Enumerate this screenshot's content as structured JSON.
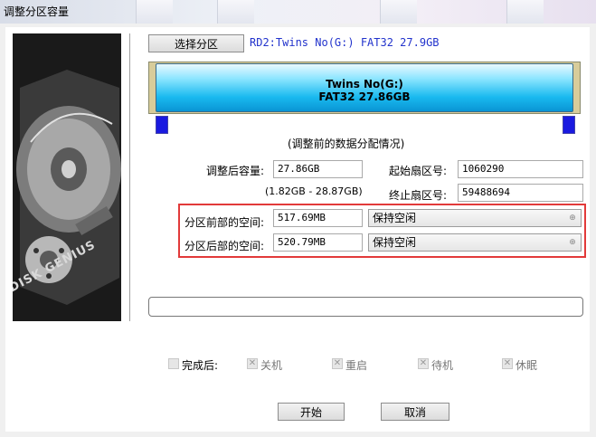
{
  "window": {
    "title": "调整分区容量"
  },
  "toolbar": {
    "select_partition_label": "选择分区"
  },
  "disk_info": "RD2:Twins No(G:) FAT32 27.9GB",
  "partition_bar": {
    "name": "Twins No(G:)",
    "detail": "FAT32 27.86GB"
  },
  "caption": "(调整前的数据分配情况)",
  "form": {
    "new_size_label": "调整后容量:",
    "new_size_value": "27.86GB",
    "size_range": "(1.82GB - 28.87GB)",
    "start_sector_label": "起始扇区号:",
    "start_sector_value": "1060290",
    "end_sector_label": "终止扇区号:",
    "end_sector_value": "59488694",
    "space_before_label": "分区前部的空间:",
    "space_before_value": "517.69MB",
    "space_before_option": "保持空闲",
    "space_after_label": "分区后部的空间:",
    "space_after_value": "520.79MB",
    "space_after_option": "保持空闲"
  },
  "after_completion": {
    "label": "完成后:",
    "options": [
      "关机",
      "重启",
      "待机",
      "休眠"
    ]
  },
  "buttons": {
    "start": "开始",
    "cancel": "取消"
  },
  "artwork": {
    "brand": "DISK GENIUS"
  },
  "colors": {
    "highlight_box": "#e23a3a",
    "partition_fill": "#19b9ef",
    "handle": "#1a1ae0",
    "disk_info_text": "#2233cc"
  }
}
